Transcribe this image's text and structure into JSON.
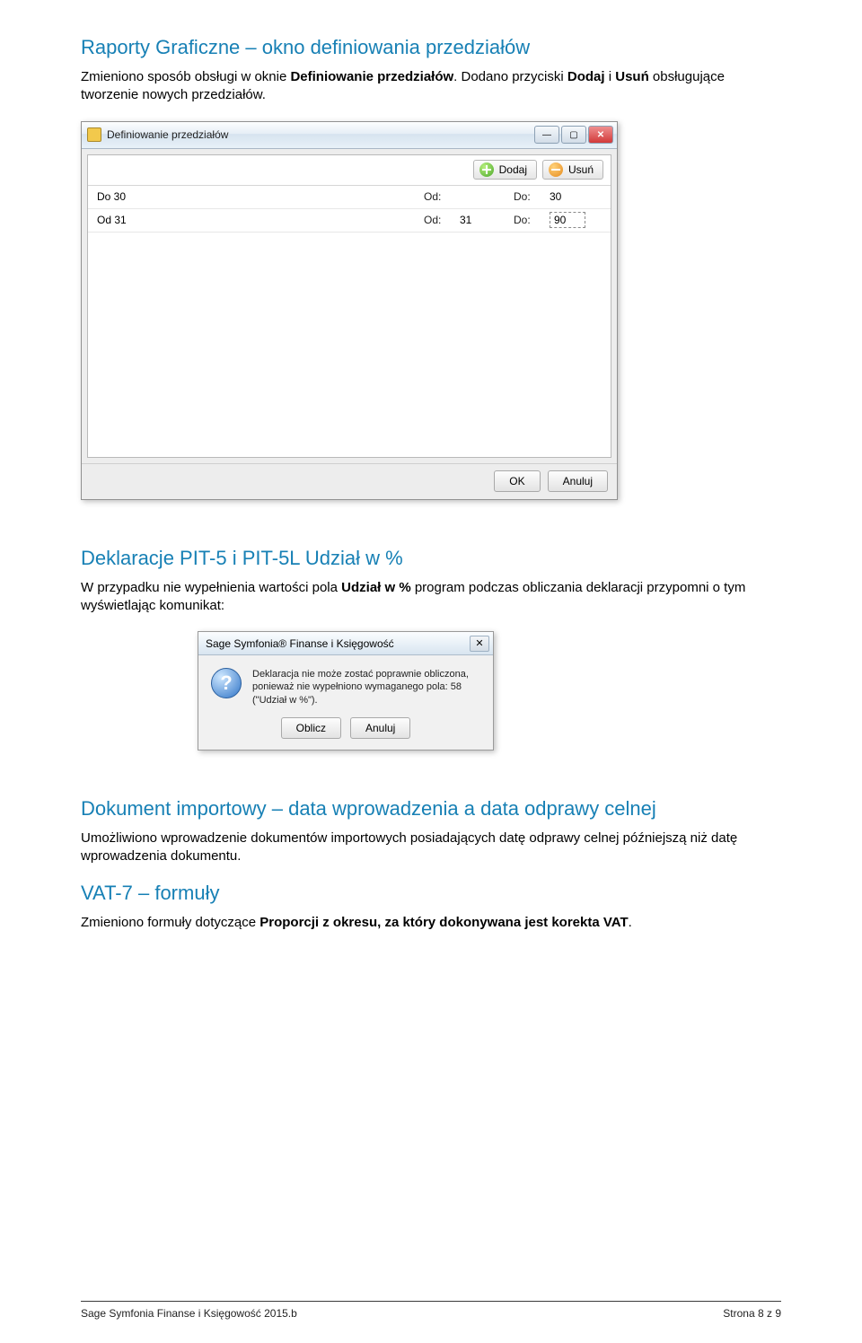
{
  "h1": "Raporty Graficzne – okno definiowania przedziałów",
  "p1a": "Zmieniono sposób obsługi w oknie ",
  "p1b": "Definiowanie przedziałów",
  "p1c": ". Dodano przyciski ",
  "p1d": "Dodaj",
  "p1e": " i ",
  "p1f": "Usuń",
  "p1g": " obsługujące tworzenie nowych przedziałów.",
  "win1": {
    "title": "Definiowanie przedziałów",
    "add": "Dodaj",
    "del": "Usuń",
    "rows": [
      {
        "name": "Do 30",
        "odLabel": "Od:",
        "od": "",
        "doLabel": "Do:",
        "do": "30"
      },
      {
        "name": "Od 31",
        "odLabel": "Od:",
        "od": "31",
        "doLabel": "Do:",
        "do": "90"
      }
    ],
    "ok": "OK",
    "cancel": "Anuluj"
  },
  "h2": "Deklaracje PIT-5 i PIT-5L Udział w %",
  "p2a": "W przypadku nie wypełnienia wartości pola ",
  "p2b": "Udział w %",
  "p2c": " program podczas obliczania deklaracji przypomni o tym wyświetlając komunikat:",
  "dlg": {
    "title": "Sage Symfonia® Finanse i Księgowość",
    "msg": "Deklaracja nie może zostać poprawnie obliczona, ponieważ nie wypełniono wymaganego pola: 58 (\"Udział w %\").",
    "btn1": "Oblicz",
    "btn2": "Anuluj"
  },
  "h3": "Dokument importowy – data wprowadzenia a data odprawy celnej",
  "p3": "Umożliwiono wprowadzenie dokumentów importowych posiadających datę odprawy celnej późniejszą niż datę wprowadzenia dokumentu.",
  "h4": "VAT-7 – formuły",
  "p4a": "Zmieniono formuły dotyczące ",
  "p4b": "Proporcji z okresu, za który dokonywana jest korekta VAT",
  "p4c": ".",
  "footerLeft": "Sage Symfonia Finanse i Księgowość 2015.b",
  "footerRight": "Strona 8 z 9"
}
